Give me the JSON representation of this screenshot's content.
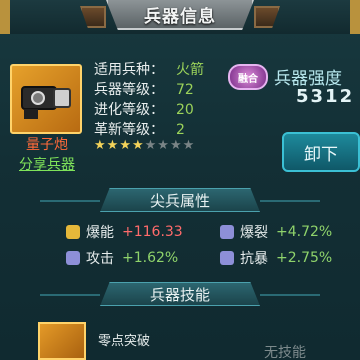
{
  "title": "兵器信息",
  "weapon": {
    "name": "量子炮",
    "share_label": "分享兵器",
    "stats": [
      {
        "label": "适用兵种：",
        "value": "火箭"
      },
      {
        "label": "兵器等级：",
        "value": "72"
      },
      {
        "label": "进化等级：",
        "value": "20"
      },
      {
        "label": "革新等级：",
        "value": "2"
      }
    ],
    "stars_filled": 4,
    "stars_total": 8
  },
  "badge_label": "融合",
  "power": {
    "label": "兵器强度",
    "value": "5312"
  },
  "unequip_label": "卸下",
  "sections": {
    "attributes": "尖兵属性",
    "skills": "兵器技能"
  },
  "attributes": [
    {
      "icon": "burst-icon",
      "name": "爆能",
      "value": "+116.33",
      "highlight": true
    },
    {
      "icon": "crit-icon",
      "name": "爆裂",
      "value": "+4.72%"
    },
    {
      "icon": "attack-icon",
      "name": "攻击",
      "value": "+1.62%"
    },
    {
      "icon": "resist-icon",
      "name": "抗暴",
      "value": "+2.75%"
    }
  ],
  "skill": {
    "name": "零点突破"
  },
  "no_skill_label": "无技能"
}
